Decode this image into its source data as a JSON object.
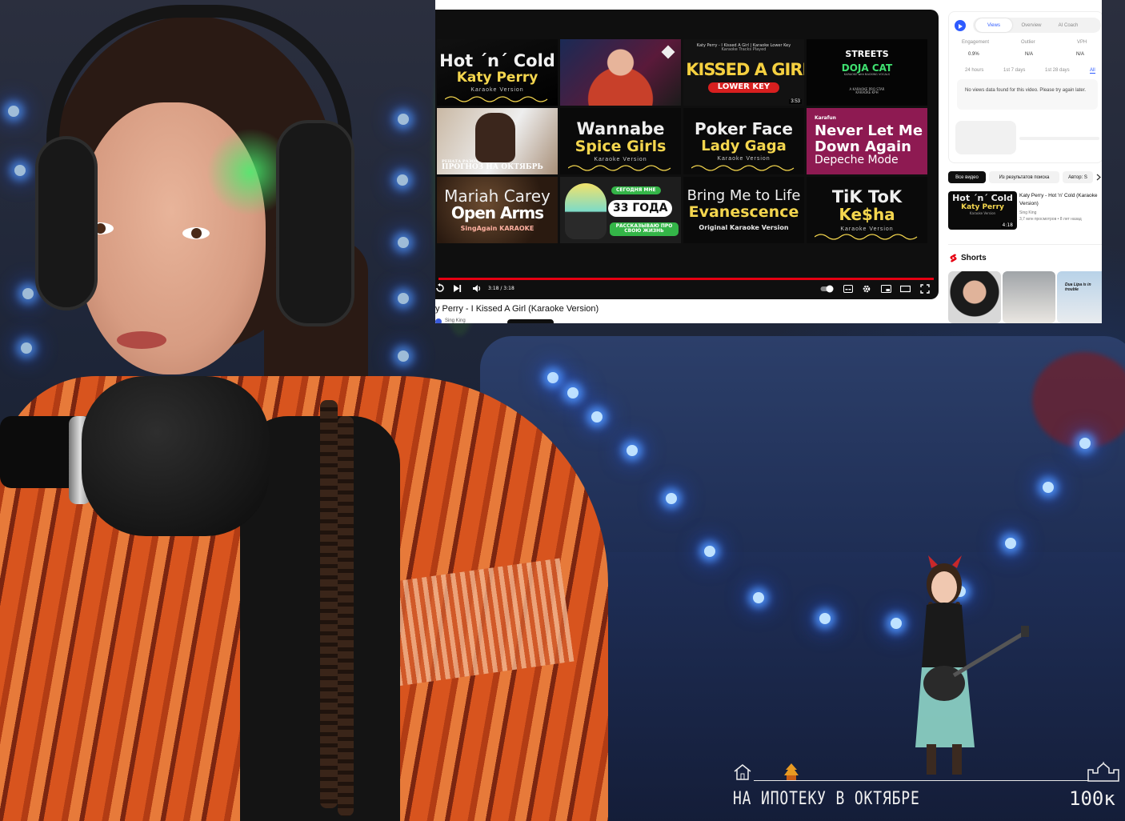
{
  "player": {
    "time": "3:18 / 3:18",
    "video_title": "y Perry - I Kissed A Girl (Karaoke Version)",
    "channel": "Sing King"
  },
  "endscreen": [
    {
      "l1": "Hot ´n´ Cold",
      "l2": "Katy Perry",
      "l3": "Karaoke Version"
    },
    {
      "l1": "",
      "l2": "",
      "l3": ""
    },
    {
      "top": "Katy Perry - I Kissed A Girl | Karaoke Lower Key",
      "sub": "Karaoke Tracks Played",
      "l1": "I KISSED A GIRL",
      "l2": "LOWER KEY",
      "time": "3:53"
    },
    {
      "l1": "STREETS",
      "l2": "DOJA CAT",
      "l3": "KARAOKE with BACKING VOCALS",
      "l4": "A KARAOKE PRO STAR KARAOKE KPH"
    },
    {
      "l1": "РЕНАТА РАЗОХЛАЯ",
      "l2": "ПРОГНОЗ НА ОКТЯБРЬ"
    },
    {
      "l1": "Wannabe",
      "l2": "Spice Girls",
      "l3": "Karaoke Version"
    },
    {
      "l1": "Poker Face",
      "l2": "Lady Gaga",
      "l3": "Karaoke Version"
    },
    {
      "brand": "Karafun",
      "l1": "Never Let Me",
      "l2": "Down Again",
      "l3": "Depeche Mode"
    },
    {
      "l1": "Mariah Carey",
      "l2": "Open Arms",
      "l3": "SingAgain KARAOKE"
    },
    {
      "l1": "СЕГОДНЯ МНЕ",
      "l2": "33 ГОДА",
      "l3": "РАССКАЗЫВАЮ ПРО СВОЮ ЖИЗНЬ"
    },
    {
      "l1": "Bring Me to Life",
      "l2": "Evanescence",
      "l3": "Original Karaoke Version"
    },
    {
      "l1": "TiK ToK",
      "l2": "Ke$ha",
      "l3": "Karaoke Version"
    }
  ],
  "extension": {
    "tabs": [
      "Views",
      "Overview",
      "AI Coach"
    ],
    "metrics": [
      {
        "label": "Engagement",
        "value": "0.9%"
      },
      {
        "label": "Outlier",
        "value": "N/A"
      },
      {
        "label": "VPH",
        "value": "N/A"
      }
    ],
    "ranges": [
      "24 hours",
      "1st 7 days",
      "1st 28 days",
      "All"
    ],
    "message": "No views data found for this video. Please try again later."
  },
  "filters": [
    "Все видео",
    "Из результатов поиска",
    "Автор: S"
  ],
  "suggestion": {
    "thumb_l1": "Hot ´n´ Cold",
    "thumb_l2": "Katy Perry",
    "thumb_l3": "Karaoke Version",
    "duration": "4:18",
    "title": "Katy Perry - Hot 'n' Cold (Karaoke Version)",
    "channel": "Sing King",
    "meta": "3,7 млн просмотров • 8 лет назад"
  },
  "shorts": {
    "label": "Shorts",
    "third_caption": "Dua Lipa is in trouble"
  },
  "overlay": {
    "goal": "НА ИПОТЕКУ В ОКТЯБРЕ",
    "target": "100к"
  },
  "colors": {
    "accent_red": "#e60012",
    "led_blue": "#4a8dff"
  }
}
